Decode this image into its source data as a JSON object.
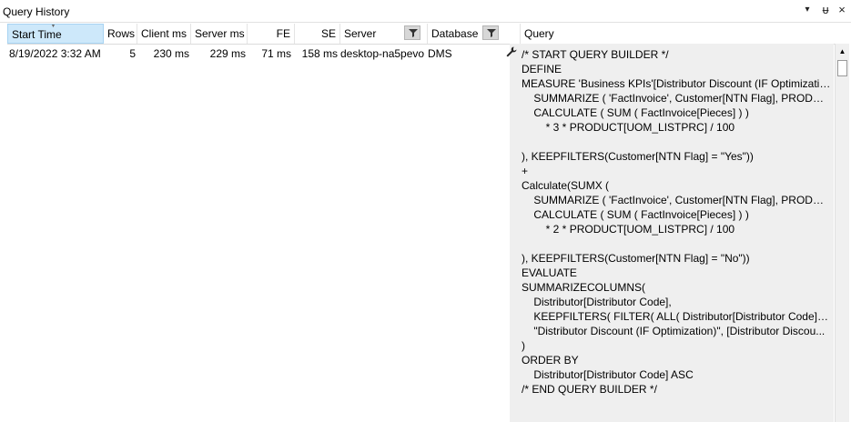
{
  "window": {
    "title": "Query History",
    "dropdown_icon": "▾",
    "pin_icon": "ᵾ",
    "close_icon": "×"
  },
  "columns": {
    "start_time": "Start Time",
    "rows": "Rows",
    "client_ms": "Client ms",
    "server_ms": "Server ms",
    "fe": "FE",
    "se": "SE",
    "server": "Server",
    "database": "Database",
    "query": "Query"
  },
  "rows": [
    {
      "start_time": "8/19/2022 3:32 AM",
      "rows": "5",
      "client_ms": "230 ms",
      "server_ms": "229 ms",
      "fe": "71 ms",
      "se": "158 ms",
      "server": "desktop-na5pevo",
      "database": "DMS"
    }
  ],
  "query_lines": [
    "/* START QUERY BUILDER */",
    "DEFINE",
    "MEASURE 'Business KPIs'[Distributor Discount (IF Optimization...",
    "    SUMMARIZE ( 'FactInvoice', Customer[NTN Flag], PRODUCT[...",
    "    CALCULATE ( SUM ( FactInvoice[Pieces] ) )",
    "        * 3 * PRODUCT[UOM_LISTPRC] / 100",
    "",
    "), KEEPFILTERS(Customer[NTN Flag] = \"Yes\"))",
    "+",
    "Calculate(SUMX (",
    "    SUMMARIZE ( 'FactInvoice', Customer[NTN Flag], PRODUCT[...",
    "    CALCULATE ( SUM ( FactInvoice[Pieces] ) )",
    "        * 2 * PRODUCT[UOM_LISTPRC] / 100",
    "",
    "), KEEPFILTERS(Customer[NTN Flag] = \"No\"))",
    "EVALUATE",
    "SUMMARIZECOLUMNS(",
    "    Distributor[Distributor Code],",
    "    KEEPFILTERS( FILTER( ALL( Distributor[Distributor Code] ), SE...",
    "    \"Distributor Discount (IF Optimization)\", [Distributor Discou...",
    ")",
    "ORDER BY",
    "    Distributor[Distributor Code] ASC",
    "/* END QUERY BUILDER */"
  ],
  "icons": {
    "sort": "sort-descending-icon",
    "filter": "filter-icon",
    "wrench": "wrench-icon"
  },
  "colors": {
    "sorted_header": "#cde8fa",
    "query_background": "#efefef"
  }
}
